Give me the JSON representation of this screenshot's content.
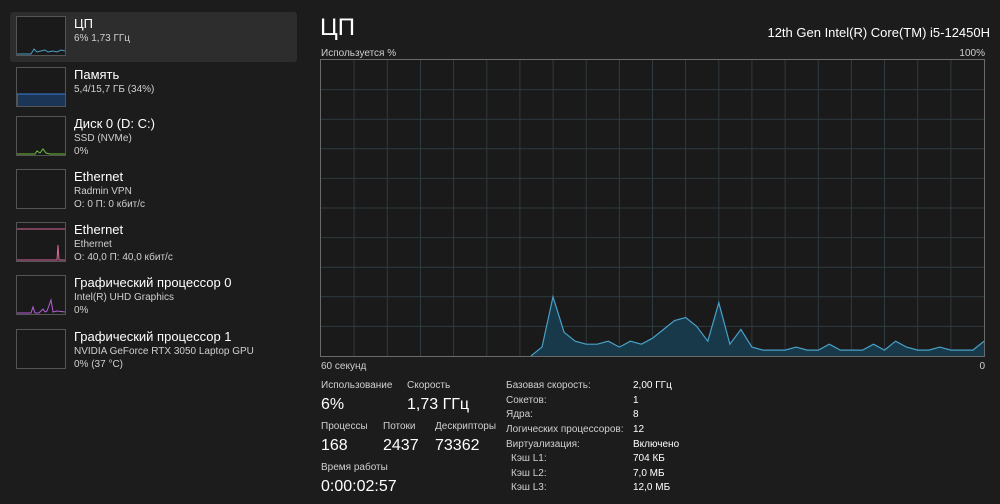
{
  "sidebar": {
    "items": [
      {
        "name": "ЦП",
        "sub1": "6% 1,73 ГГц",
        "sub2": ""
      },
      {
        "name": "Память",
        "sub1": "5,4/15,7 ГБ (34%)",
        "sub2": ""
      },
      {
        "name": "Диск 0 (D: C:)",
        "sub1": "SSD (NVMe)",
        "sub2": "0%"
      },
      {
        "name": "Ethernet",
        "sub1": "Radmin VPN",
        "sub2": "О: 0 П: 0 кбит/с"
      },
      {
        "name": "Ethernet",
        "sub1": "Ethernet",
        "sub2": "О: 40,0 П: 40,0 кбит/с"
      },
      {
        "name": "Графический процессор 0",
        "sub1": "Intel(R) UHD Graphics",
        "sub2": "0%"
      },
      {
        "name": "Графический процессор 1",
        "sub1": "NVIDIA GeForce RTX 3050 Laptop GPU",
        "sub2": "0%  (37 °C)"
      }
    ]
  },
  "main": {
    "title": "ЦП",
    "model": "12th Gen Intel(R) Core(TM) i5-12450H",
    "graph_label": "Используется %",
    "graph_max": "100%",
    "time_left": "60 секунд",
    "time_right": "0"
  },
  "stats": {
    "usage_label": "Использование",
    "usage_value": "6%",
    "speed_label": "Скорость",
    "speed_value": "1,73 ГГц",
    "processes_label": "Процессы",
    "processes_value": "168",
    "threads_label": "Потоки",
    "threads_value": "2437",
    "handles_label": "Дескрипторы",
    "handles_value": "73362",
    "uptime_label": "Время работы",
    "uptime_value": "0:00:02:57"
  },
  "specs": [
    {
      "key": "Базовая скорость:",
      "value": "2,00 ГГц"
    },
    {
      "key": "Сокетов:",
      "value": "1"
    },
    {
      "key": "Ядра:",
      "value": "8"
    },
    {
      "key": "Логических процессоров:",
      "value": "12"
    },
    {
      "key": "Виртуализация:",
      "value": "Включено"
    },
    {
      "key": "Кэш L1:",
      "value": "704 КБ"
    },
    {
      "key": "Кэш L2:",
      "value": "7,0 МБ"
    },
    {
      "key": "Кэш L3:",
      "value": "12,0 МБ"
    }
  ],
  "colors": {
    "cpu_line": "#4aa0c8",
    "cpu_fill": "#17394a",
    "memory_line": "#3a7fd6",
    "disk_line": "#6fbf3a",
    "ethernet_line": "#d96a9a",
    "gpu_line": "#b45fd6",
    "grid": "#2e3a3f"
  },
  "chart_data": {
    "type": "area",
    "ylabel": "Используется %",
    "ylim": [
      0,
      100
    ],
    "xlim": [
      60,
      0
    ],
    "x": [
      60,
      59,
      58,
      57,
      56,
      55,
      54,
      53,
      52,
      51,
      50,
      49,
      48,
      47,
      46,
      45,
      44,
      43,
      42,
      41,
      40,
      39,
      38,
      37,
      36,
      35,
      34,
      33,
      32,
      31,
      30,
      29,
      28,
      27,
      26,
      25,
      24,
      23,
      22,
      21,
      20,
      19,
      18,
      17,
      16,
      15,
      14,
      13,
      12,
      11,
      10,
      9,
      8,
      7,
      6,
      5,
      4,
      3,
      2,
      1,
      0
    ],
    "series": [
      {
        "values": [
          0,
          0,
          0,
          0,
          0,
          0,
          0,
          0,
          0,
          0,
          0,
          0,
          0,
          0,
          0,
          0,
          0,
          0,
          0,
          0,
          3,
          20,
          8,
          5,
          4,
          4,
          5,
          3,
          5,
          4,
          6,
          9,
          12,
          13,
          10,
          5,
          18,
          4,
          9,
          3,
          2,
          2,
          2,
          3,
          2,
          2,
          4,
          2,
          2,
          2,
          4,
          2,
          5,
          3,
          2,
          2,
          3,
          2,
          2,
          2,
          5
        ]
      }
    ]
  }
}
